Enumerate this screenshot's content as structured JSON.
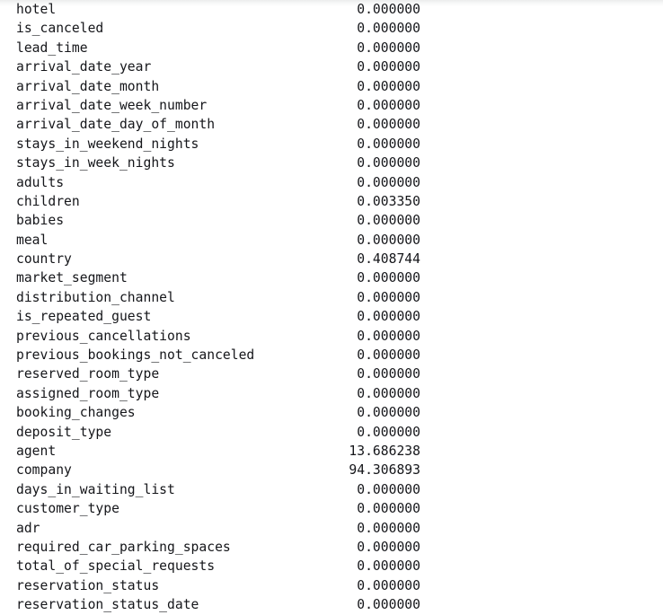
{
  "output": {
    "kind": "pandas-series-text-output",
    "index_label": "",
    "value_label": "",
    "rows": [
      {
        "name": "hotel",
        "value": "0.000000"
      },
      {
        "name": "is_canceled",
        "value": "0.000000"
      },
      {
        "name": "lead_time",
        "value": "0.000000"
      },
      {
        "name": "arrival_date_year",
        "value": "0.000000"
      },
      {
        "name": "arrival_date_month",
        "value": "0.000000"
      },
      {
        "name": "arrival_date_week_number",
        "value": "0.000000"
      },
      {
        "name": "arrival_date_day_of_month",
        "value": "0.000000"
      },
      {
        "name": "stays_in_weekend_nights",
        "value": "0.000000"
      },
      {
        "name": "stays_in_week_nights",
        "value": "0.000000"
      },
      {
        "name": "adults",
        "value": "0.000000"
      },
      {
        "name": "children",
        "value": "0.003350"
      },
      {
        "name": "babies",
        "value": "0.000000"
      },
      {
        "name": "meal",
        "value": "0.000000"
      },
      {
        "name": "country",
        "value": "0.408744"
      },
      {
        "name": "market_segment",
        "value": "0.000000"
      },
      {
        "name": "distribution_channel",
        "value": "0.000000"
      },
      {
        "name": "is_repeated_guest",
        "value": "0.000000"
      },
      {
        "name": "previous_cancellations",
        "value": "0.000000"
      },
      {
        "name": "previous_bookings_not_canceled",
        "value": "0.000000"
      },
      {
        "name": "reserved_room_type",
        "value": "0.000000"
      },
      {
        "name": "assigned_room_type",
        "value": "0.000000"
      },
      {
        "name": "booking_changes",
        "value": "0.000000"
      },
      {
        "name": "deposit_type",
        "value": "0.000000"
      },
      {
        "name": "agent",
        "value": "13.686238"
      },
      {
        "name": "company",
        "value": "94.306893"
      },
      {
        "name": "days_in_waiting_list",
        "value": "0.000000"
      },
      {
        "name": "customer_type",
        "value": "0.000000"
      },
      {
        "name": "adr",
        "value": "0.000000"
      },
      {
        "name": "required_car_parking_spaces",
        "value": "0.000000"
      },
      {
        "name": "total_of_special_requests",
        "value": "0.000000"
      },
      {
        "name": "reservation_status",
        "value": "0.000000"
      },
      {
        "name": "reservation_status_date",
        "value": "0.000000"
      }
    ]
  },
  "colors": {
    "text": "#15161a",
    "background": "#ffffff",
    "top_shadow": "#eceded"
  }
}
